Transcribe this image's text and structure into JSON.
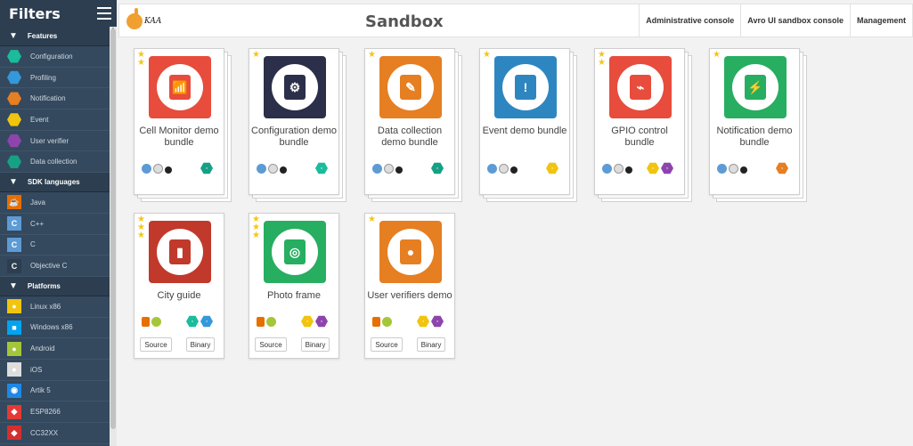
{
  "sidebar": {
    "title": "Filters",
    "sections": [
      {
        "label": "Features",
        "items": [
          {
            "label": "Configuration",
            "icon": "configuration-icon",
            "color": "#1abc9c"
          },
          {
            "label": "Profiling",
            "icon": "profiling-icon",
            "color": "#3498db"
          },
          {
            "label": "Notification",
            "icon": "notification-icon",
            "color": "#e67e22"
          },
          {
            "label": "Event",
            "icon": "event-icon",
            "color": "#f1c40f"
          },
          {
            "label": "User verifier",
            "icon": "user-verifier-icon",
            "color": "#8e44ad"
          },
          {
            "label": "Data collection",
            "icon": "data-collection-icon",
            "color": "#16a085"
          }
        ]
      },
      {
        "label": "SDK languages",
        "items": [
          {
            "label": "Java",
            "icon": "java-icon",
            "color": "#e76f00"
          },
          {
            "label": "C++",
            "icon": "cpp-icon",
            "color": "#5d9bd5"
          },
          {
            "label": "C",
            "icon": "c-icon",
            "color": "#5d9bd5"
          },
          {
            "label": "Objective C",
            "icon": "objective-c-icon",
            "color": "#2c3e50"
          }
        ]
      },
      {
        "label": "Platforms",
        "items": [
          {
            "label": "Linux x86",
            "icon": "linux-icon",
            "color": "#f1c40f"
          },
          {
            "label": "Windows x86",
            "icon": "windows-icon",
            "color": "#00a4ef"
          },
          {
            "label": "Android",
            "icon": "android-icon",
            "color": "#a4c639"
          },
          {
            "label": "iOS",
            "icon": "apple-icon",
            "color": "#dddddd"
          },
          {
            "label": "Artik 5",
            "icon": "artik-icon",
            "color": "#1e88e5"
          },
          {
            "label": "ESP8266",
            "icon": "esp8266-icon",
            "color": "#e53935"
          },
          {
            "label": "CC32XX",
            "icon": "cc32xx-icon",
            "color": "#d32f2f"
          }
        ]
      }
    ]
  },
  "header": {
    "logo_text": "KAA",
    "title": "Sandbox",
    "nav": [
      "Administrative console",
      "Avro UI sandbox console",
      "Management"
    ]
  },
  "cards": [
    {
      "name": "Cell Monitor demo bundle",
      "stars": 2,
      "color": "#e74c3c",
      "icon": "cell-tower-icon",
      "feature_colors": [
        "#16a085"
      ],
      "stacked": true,
      "buttons": []
    },
    {
      "name": "Configuration demo bundle",
      "stars": 1,
      "color": "#2c2f4a",
      "icon": "configuration-icon",
      "feature_colors": [
        "#1abc9c"
      ],
      "stacked": true,
      "buttons": []
    },
    {
      "name": "Data collection demo bundle",
      "stars": 1,
      "color": "#e67e22",
      "icon": "data-collection-icon",
      "feature_colors": [
        "#16a085"
      ],
      "stacked": true,
      "buttons": []
    },
    {
      "name": "Event demo bundle",
      "stars": 1,
      "color": "#2e86c1",
      "icon": "event-icon",
      "feature_colors": [
        "#f1c40f"
      ],
      "stacked": true,
      "buttons": []
    },
    {
      "name": "GPIO control bundle",
      "stars": 2,
      "color": "#e74c3c",
      "icon": "gpio-icon",
      "feature_colors": [
        "#f1c40f",
        "#8e44ad"
      ],
      "stacked": true,
      "buttons": []
    },
    {
      "name": "Notification demo bundle",
      "stars": 1,
      "color": "#27ae60",
      "icon": "notification-icon",
      "feature_colors": [
        "#e67e22"
      ],
      "stacked": true,
      "buttons": []
    },
    {
      "name": "City guide",
      "stars": 3,
      "color": "#c0392b",
      "icon": "city-icon",
      "feature_colors": [
        "#1abc9c",
        "#3498db"
      ],
      "stacked": false,
      "buttons": [
        "Source",
        "Binary"
      ]
    },
    {
      "name": "Photo frame",
      "stars": 3,
      "color": "#27ae60",
      "icon": "camera-icon",
      "feature_colors": [
        "#f1c40f",
        "#8e44ad"
      ],
      "stacked": false,
      "buttons": [
        "Source",
        "Binary"
      ]
    },
    {
      "name": "User verifiers demo",
      "stars": 1,
      "color": "#e67e22",
      "icon": "user-icon",
      "feature_colors": [
        "#f1c40f",
        "#8e44ad"
      ],
      "stacked": false,
      "buttons": [
        "Source",
        "Binary"
      ]
    }
  ]
}
